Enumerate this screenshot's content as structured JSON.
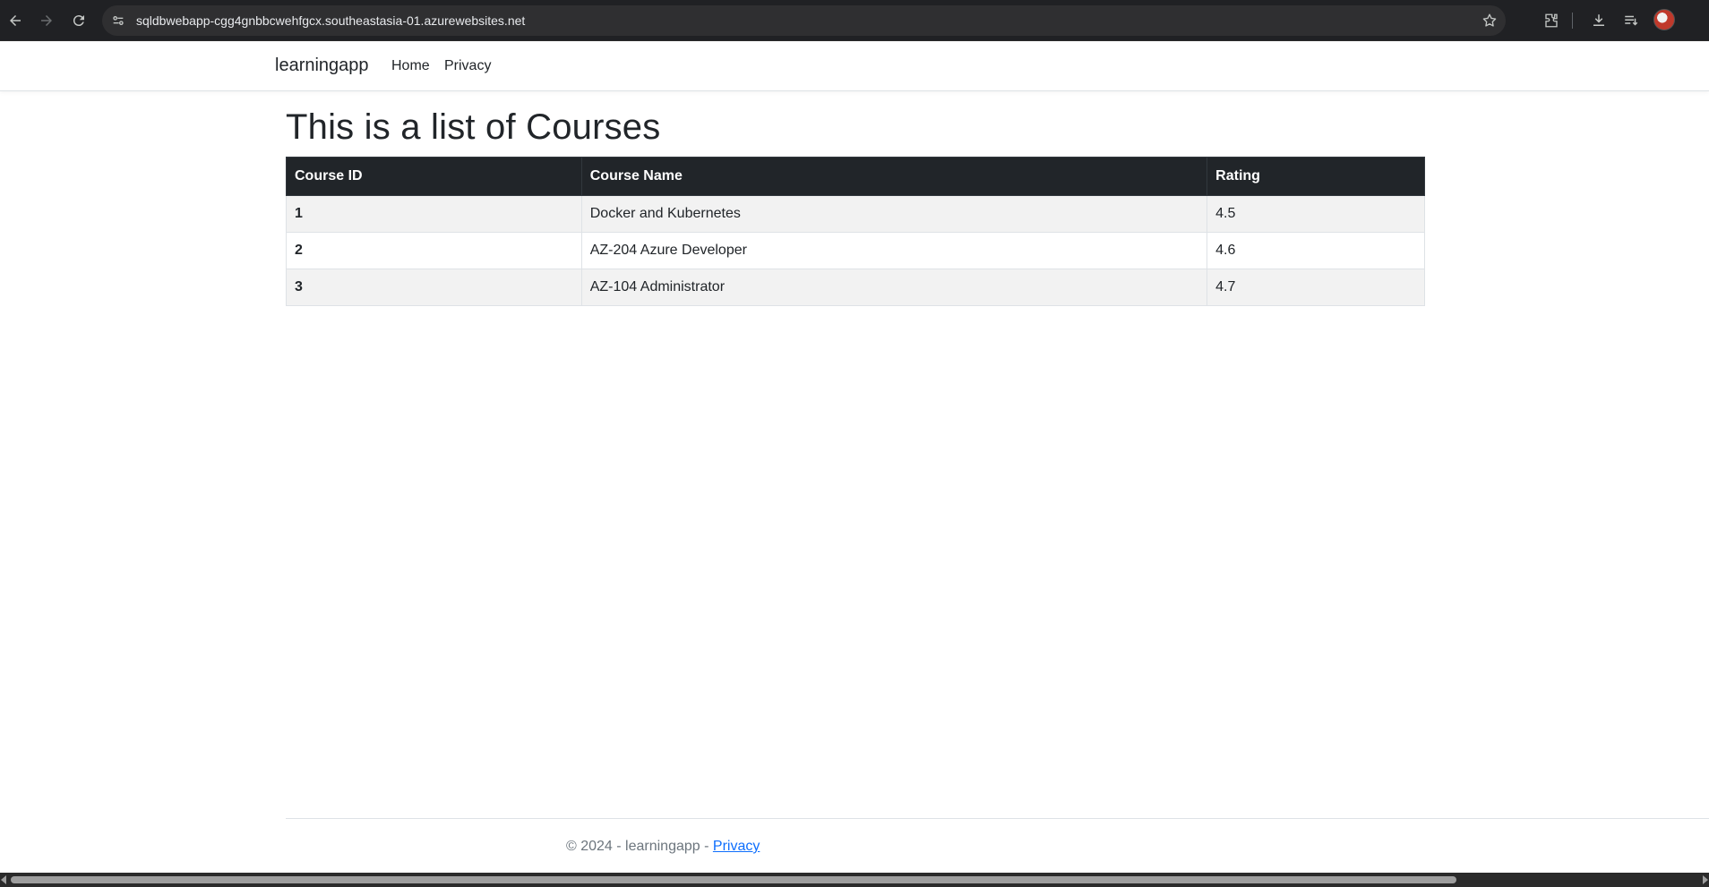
{
  "browser": {
    "url": "sqldbwebapp-cgg4gnbbcwehfgcx.southeastasia-01.azurewebsites.net",
    "icons": [
      "back-icon",
      "forward-icon",
      "reload-icon",
      "site-info-icon",
      "bookmark-star-icon",
      "extensions-icon",
      "download-icon",
      "reading-list-icon",
      "profile-avatar"
    ]
  },
  "navbar": {
    "brand": "learningapp",
    "links": [
      "Home",
      "Privacy"
    ]
  },
  "main": {
    "title": "This is a list of Courses",
    "table": {
      "headers": [
        "Course ID",
        "Course Name",
        "Rating"
      ],
      "rows": [
        [
          "1",
          "Docker and Kubernetes",
          "4.5"
        ],
        [
          "2",
          "AZ-204 Azure Developer",
          "4.6"
        ],
        [
          "3",
          "AZ-104 Administrator",
          "4.7"
        ]
      ]
    }
  },
  "footer": {
    "text": "© 2024 - learningapp - ",
    "link": "Privacy"
  },
  "colors": {
    "browser_bg": "#202124",
    "table_header_bg": "#212529",
    "stripe_bg": "#f2f2f2",
    "link": "#0d6efd"
  }
}
